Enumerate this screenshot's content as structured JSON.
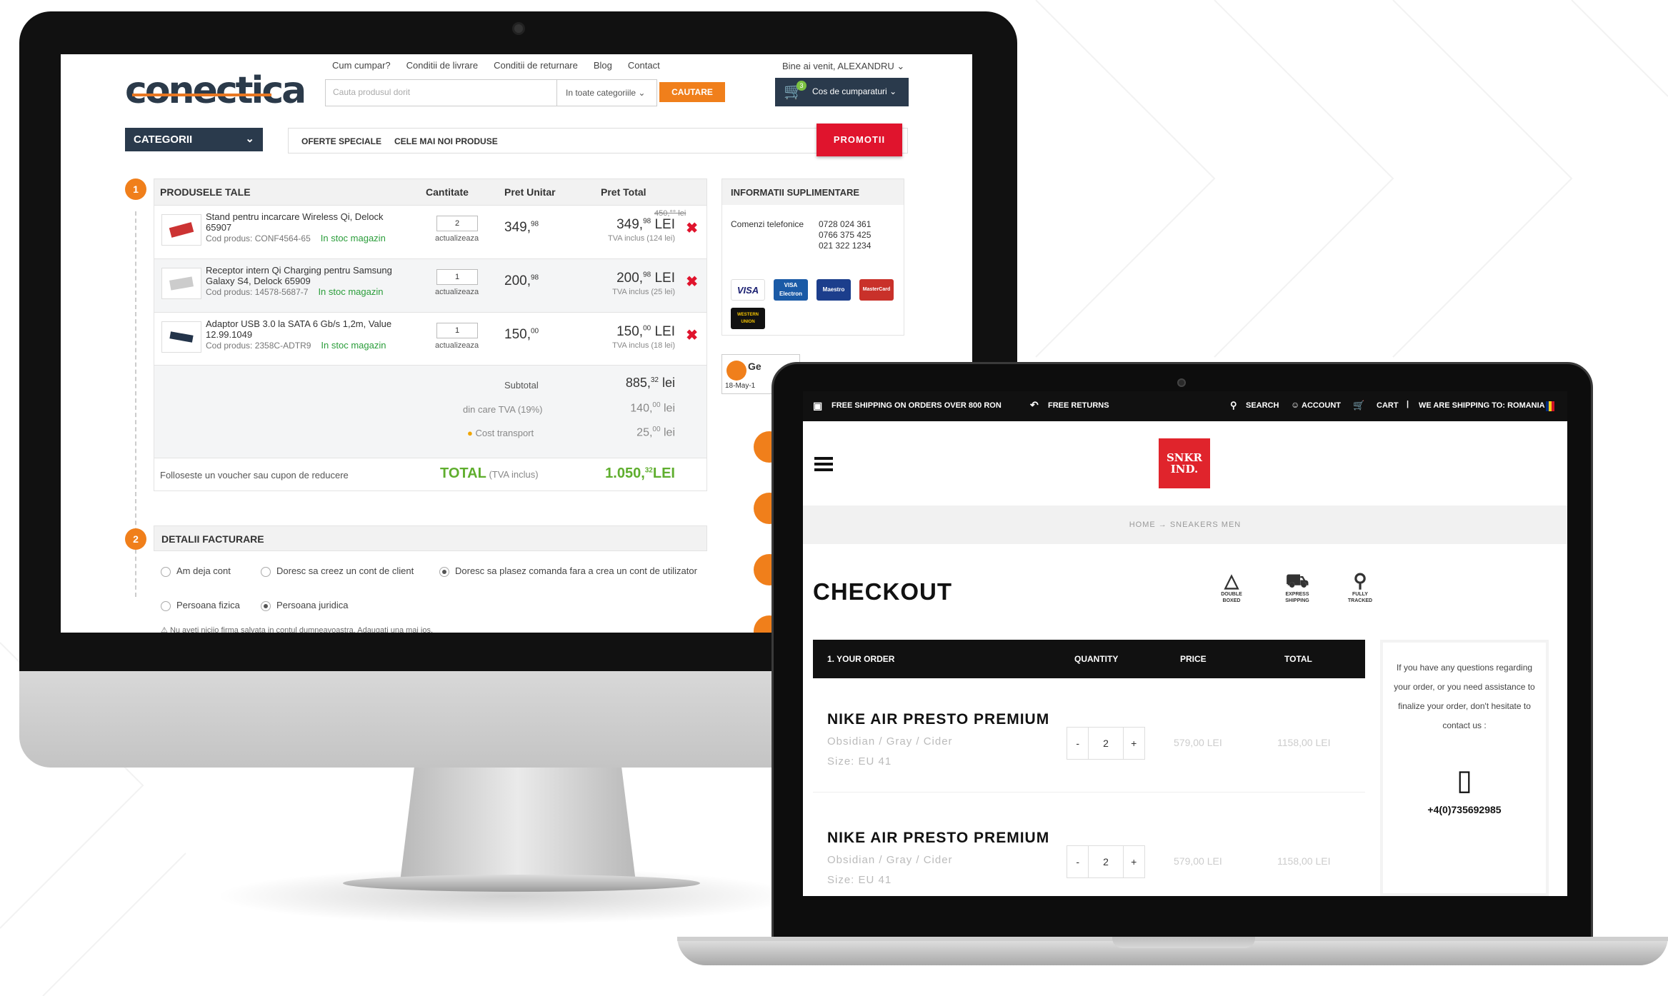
{
  "conectica": {
    "toplinks": [
      "Cum cumpar?",
      "Conditii de livrare",
      "Conditii de returnare",
      "Blog",
      "Contact"
    ],
    "welcome": "Bine ai venit, ALEXANDRU",
    "logo": "conectica",
    "search_placeholder": "Cauta produsul dorit",
    "category_select": "In toate categoriile",
    "search_button": "CAUTARE",
    "cart_label": "Cos de cumparaturi",
    "cart_count": "3",
    "categorii": "CATEGORII",
    "nav": [
      "OFERTE SPECIALE",
      "CELE MAI NOI PRODUSE"
    ],
    "promo": "PROMOTII",
    "step1": "1",
    "step2": "2",
    "table_header": {
      "products": "PRODUSELE TALE",
      "qty": "Cantitate",
      "unit": "Pret Unitar",
      "total": "Pret Total"
    },
    "items": [
      {
        "name": "Stand pentru incarcare Wireless Qi, Delock 65907",
        "code": "Cod produs: CONF4564-65",
        "stock": "In stoc magazin",
        "qty": "2",
        "update": "actualizeaza",
        "unit_main": "349,",
        "unit_dec": "98",
        "old": "450,°° lei",
        "total_main": "349,",
        "total_dec": "98",
        "total_cur": " LEI",
        "tva": "TVA inclus (124 lei)"
      },
      {
        "name": "Receptor intern Qi Charging pentru Samsung Galaxy S4, Delock 65909",
        "code": "Cod produs: 14578-5687-7",
        "stock": "In stoc magazin",
        "qty": "1",
        "update": "actualizeaza",
        "unit_main": "200,",
        "unit_dec": "98",
        "old": "",
        "total_main": "200,",
        "total_dec": "98",
        "total_cur": " LEI",
        "tva": "TVA inclus (25 lei)"
      },
      {
        "name": "Adaptor USB 3.0 la SATA 6 Gb/s 1,2m, Value 12.99.1049",
        "code": "Cod produs: 2358C-ADTR9",
        "stock": "In stoc magazin",
        "qty": "1",
        "update": "actualizeaza",
        "unit_main": "150,",
        "unit_dec": "00",
        "old": "",
        "total_main": "150,",
        "total_dec": "00",
        "total_cur": " LEI",
        "tva": "TVA inclus (18 lei)"
      }
    ],
    "subtotal_label": "Subtotal",
    "subtotal_main": "885,",
    "subtotal_dec": "32",
    "tva_label": "din care TVA (19%)",
    "tva_main": "140,",
    "tva_dec": "00",
    "transport_label": "Cost transport",
    "transport_main": "25,",
    "transport_dec": "00",
    "lei": " lei",
    "voucher": "Folloseste un voucher sau cupon de reducere",
    "total_label": "TOTAL",
    "total_note": "(TVA inclus)",
    "total_main": "1.050,",
    "total_dec": "32",
    "total_cur": "LEI",
    "info_header": "INFORMATII SUPLIMENTARE",
    "phone_label": "Comenzi telefonice",
    "phones": [
      "0728 024 361",
      "0766 375 425",
      "021 322 1234"
    ],
    "cards": [
      "VISA",
      "VISA Electron",
      "Maestro",
      "MasterCard",
      "WESTERN UNION"
    ],
    "badge_text": "Ge",
    "badge_date": "18-May-1",
    "fact_header": "DETALII FACTURARE",
    "radios": [
      "Am deja cont",
      "Doresc sa creez un cont de client",
      "Doresc sa plasez comanda fara a crea un cont de utilizator",
      "Persoana fizica",
      "Persoana juridica"
    ],
    "warning": "Nu aveti niciio firma salvata in contul dumneavoastra. Adaugati una mai jos."
  },
  "snkr": {
    "topbar": {
      "shipping": "FREE SHIPPING ON ORDERS OVER 800 RON",
      "returns": "FREE RETURNS",
      "search": "SEARCH",
      "account": "ACCOUNT",
      "cart": "CART",
      "country": "WE ARE SHIPPING TO: ROMANIA"
    },
    "logo": "SNKR IND.",
    "breadcrumb": "HOME  →  SNEAKERS MEN",
    "title": "CHECKOUT",
    "features": [
      {
        "l1": "DOUBLE",
        "l2": "BOXED"
      },
      {
        "l1": "EXPRESS",
        "l2": "SHIPPING"
      },
      {
        "l1": "FULLY",
        "l2": "TRACKED"
      }
    ],
    "thead": {
      "order": "1. YOUR ORDER",
      "qty": "QUANTITY",
      "price": "PRICE",
      "total": "TOTAL"
    },
    "items": [
      {
        "name": "NIKE AIR PRESTO PREMIUM",
        "variant": "Obsidian / Gray / Cider",
        "size": "Size: EU 41",
        "qty": "2",
        "price": "579,00 LEI",
        "total": "1158,00 LEI"
      },
      {
        "name": "NIKE AIR PRESTO PREMIUM",
        "variant": "Obsidian / Gray / Cider",
        "size": "Size: EU 41",
        "qty": "2",
        "price": "579,00 LEI",
        "total": "1158,00 LEI"
      }
    ],
    "minus": "-",
    "plus": "+",
    "help": "If you have any questions regarding your order, or you need assistance to finalize your order, don't hesitate to contact us :",
    "phone": "+4(0)735692985"
  }
}
